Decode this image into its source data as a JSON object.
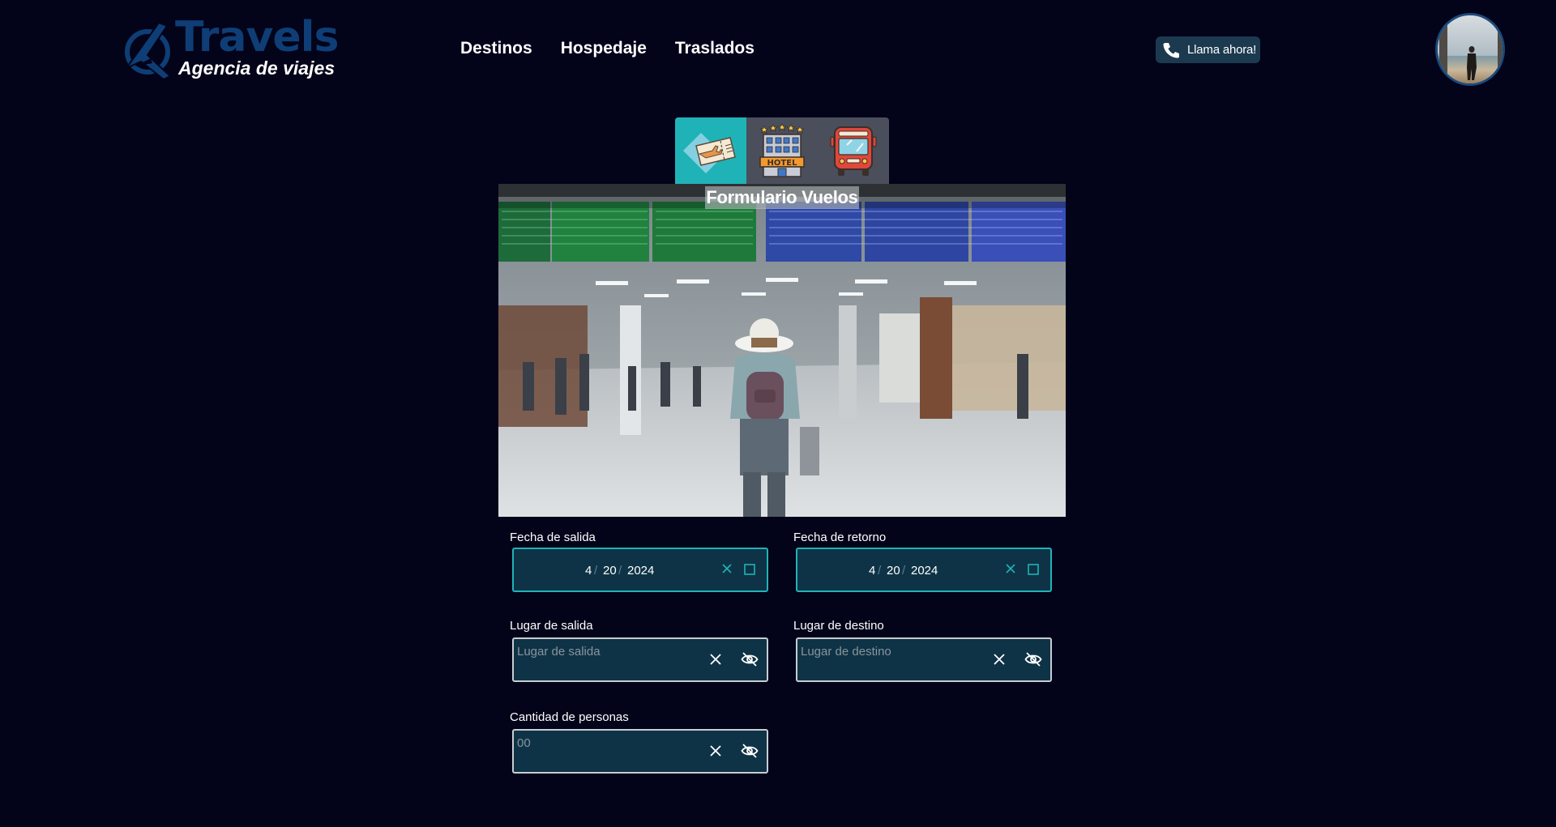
{
  "brand": {
    "title": "Travels",
    "subtitle": "Agencia de viajes"
  },
  "nav": {
    "items": [
      {
        "label": "Destinos"
      },
      {
        "label": "Hospedaje"
      },
      {
        "label": "Traslados"
      }
    ]
  },
  "call": {
    "label": "Llama ahora!"
  },
  "tabs": [
    {
      "name": "flights",
      "active": true
    },
    {
      "name": "hotel",
      "active": false
    },
    {
      "name": "bus",
      "active": false
    }
  ],
  "tab_hotel_text": "HOTEL",
  "hero": {
    "title": "Formulario Vuelos"
  },
  "form": {
    "departure_date": {
      "label": "Fecha de salida",
      "month": "4",
      "day": "20",
      "year": "2024"
    },
    "return_date": {
      "label": "Fecha de retorno",
      "month": "4",
      "day": "20",
      "year": "2024"
    },
    "departure_place": {
      "label": "Lugar de salida",
      "placeholder": "Lugar de salida",
      "value": ""
    },
    "destination_place": {
      "label": "Lugar de destino",
      "placeholder": "Lugar de destino",
      "value": ""
    },
    "people": {
      "label": "Cantidad de personas",
      "placeholder": "00",
      "value": ""
    }
  },
  "colors": {
    "background": "#03031a",
    "accent": "#1fb3b8",
    "brand": "#0e3e75",
    "field_bg": "#0e3346"
  },
  "icons": [
    "plane-logo-icon",
    "phone-icon",
    "flight-ticket-icon",
    "hotel-icon",
    "bus-icon",
    "close-icon",
    "calendar-icon",
    "eye-off-icon"
  ]
}
